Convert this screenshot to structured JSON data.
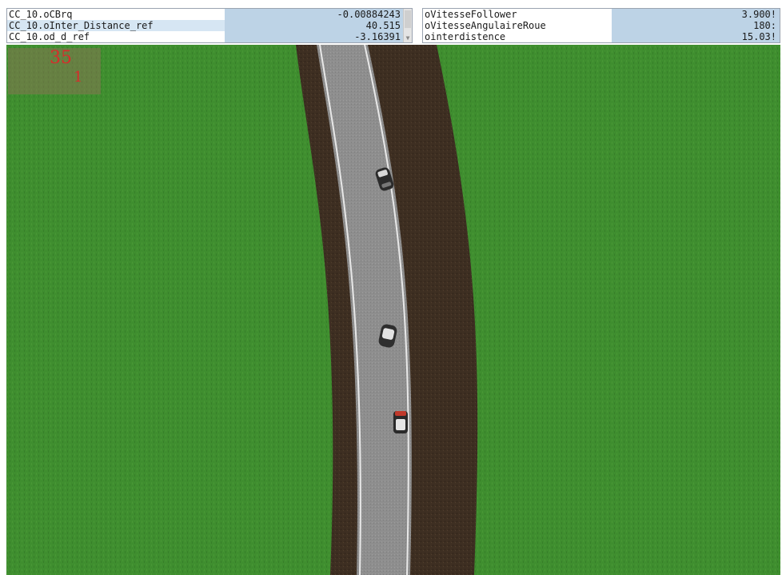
{
  "watch_left": {
    "rows": [
      {
        "name": "CC_10.oCBrq",
        "value": "-0.00884243"
      },
      {
        "name": "CC_10.oInter_Distance_ref",
        "value": "40.515"
      },
      {
        "name": "CC_10.od_d_ref",
        "value": "-3.16391"
      }
    ]
  },
  "watch_right": {
    "rows": [
      {
        "name": "oVitesseFollower",
        "value": "3.900!"
      },
      {
        "name": "oVitesseAngulaireRoue",
        "value": "180:"
      },
      {
        "name": "ointerdistence",
        "value": "15.03!"
      }
    ]
  },
  "hud": {
    "line1": "35",
    "line2": "1"
  },
  "scene": {
    "grass_color": "#3f8e2f",
    "dirt_color": "#3e2f22",
    "road_color": "#8e8e8e",
    "vehicles": [
      {
        "name": "lead-vehicle",
        "color": "#2b2b2b"
      },
      {
        "name": "middle-vehicle",
        "color": "#2e2e2e"
      },
      {
        "name": "follower-vehicle",
        "color": "#c0392b"
      }
    ]
  }
}
